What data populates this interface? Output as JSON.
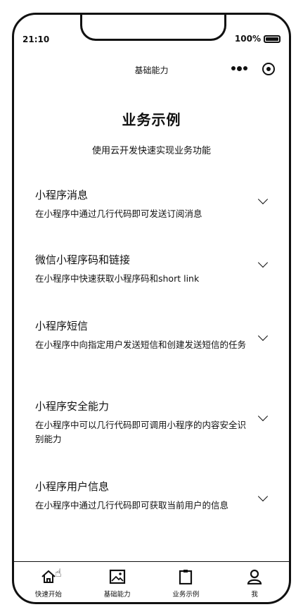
{
  "status_bar": {
    "time": "21:10",
    "battery": "100%"
  },
  "nav": {
    "title": "基础能力"
  },
  "page": {
    "title": "业务示例",
    "subtitle": "使用云开发快速实现业务功能"
  },
  "items": [
    {
      "title": "小程序消息",
      "desc": "在小程序中通过几行代码即可发送订阅消息"
    },
    {
      "title": "微信小程序码和链接",
      "desc": "在小程序中快速获取小程序码和short link"
    },
    {
      "title": "小程序短信",
      "desc": "在小程序中向指定用户发送短信和创建发送短信的任务"
    },
    {
      "title": "小程序安全能力",
      "desc": "在小程序中可以几行代码即可调用小程序的内容安全识别能力"
    },
    {
      "title": "小程序用户信息",
      "desc": "在小程序中通过几行代码即可获取当前用户的信息"
    }
  ],
  "tabbar": [
    {
      "label": "快速开始",
      "icon": "home-icon"
    },
    {
      "label": "基础能力",
      "icon": "image-icon"
    },
    {
      "label": "业务示例",
      "icon": "clipboard-icon"
    },
    {
      "label": "我",
      "icon": "user-icon"
    }
  ]
}
